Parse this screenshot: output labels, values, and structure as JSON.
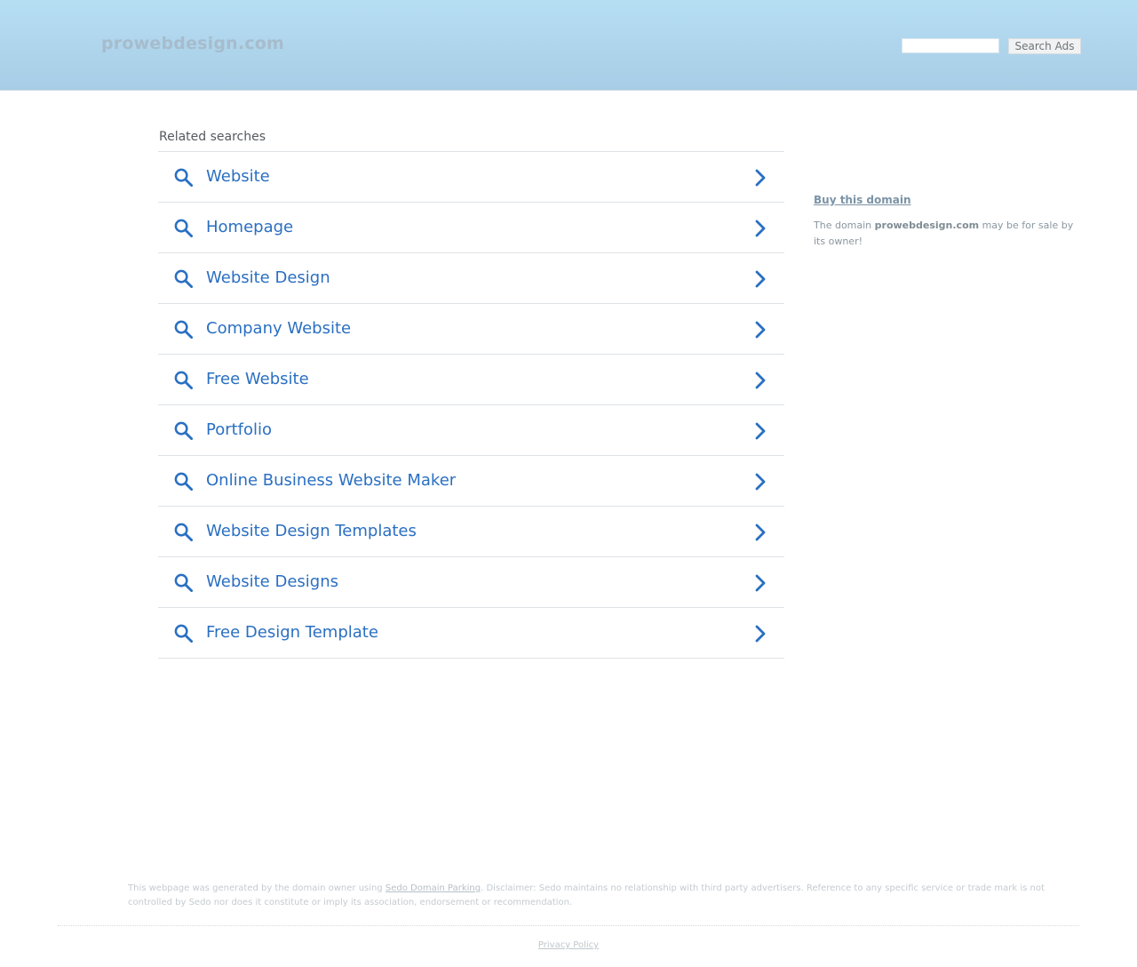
{
  "header": {
    "domain_title": "prowebdesign.com",
    "search_input_value": "",
    "search_button_label": "Search Ads"
  },
  "related": {
    "heading": "Related searches",
    "items": [
      {
        "label": "Website"
      },
      {
        "label": "Homepage"
      },
      {
        "label": "Website Design"
      },
      {
        "label": "Company Website"
      },
      {
        "label": "Free Website"
      },
      {
        "label": "Portfolio"
      },
      {
        "label": "Online Business Website Maker"
      },
      {
        "label": "Website Design Templates"
      },
      {
        "label": "Website Designs"
      },
      {
        "label": "Free Design Template"
      }
    ],
    "item_icon": "search-icon",
    "item_arrow_icon": "chevron-right-icon"
  },
  "sidebar": {
    "buy_link": "Buy this domain",
    "sale_prefix": "The domain ",
    "sale_domain": "prowebdesign.com",
    "sale_suffix": " may be for sale by its owner!"
  },
  "footer": {
    "disclaimer_prefix": "This webpage was generated by the domain owner using ",
    "disclaimer_link": "Sedo Domain Parking",
    "disclaimer_suffix": ". Disclaimer: Sedo maintains no relationship with third party advertisers. Reference to any specific service or trade mark is not controlled by Sedo nor does it constitute or imply its association, endorsement or recommendation.",
    "privacy_label": "Privacy Policy"
  },
  "colors": {
    "link_blue": "#2a6fc2",
    "header_top": "#b6def3",
    "header_bottom": "#a8cde6"
  }
}
